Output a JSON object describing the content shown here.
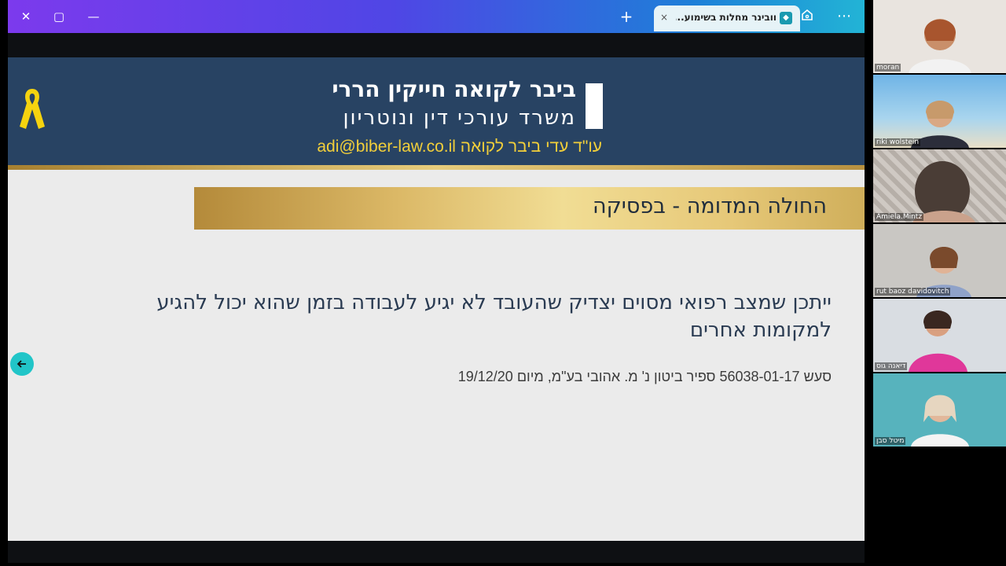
{
  "browser": {
    "tab_title": "וובינר מחלות בשימוע...",
    "tab_close": "×",
    "new_tab": "+",
    "more": "⋯",
    "window_close": "✕",
    "window_max": "▢",
    "window_min": "—"
  },
  "slide": {
    "firm_name": "ביבר לקואה חייקין הררי",
    "firm_subtitle": "משרד עורכי דין ונוטריון",
    "firm_contact": "עו\"ד עדי ביבר לקואה adi@biber-law.co.il",
    "title": "החולה המדומה - בפסיקה",
    "body": "ייתכן שמצב רפואי מסוים יצדיק שהעובד לא יגיע לעבודה בזמן שהוא יכול להגיע למקומות אחרים",
    "citation": "סעש 56038-01-17 ספיר ביטון נ' מ. אהובי בע\"מ, מיום 19/12/20"
  },
  "participants": [
    {
      "name": "moran",
      "bg": "#e9e4df"
    },
    {
      "name": "riki wolstein",
      "bg": "#7fb9d9"
    },
    {
      "name": "Amiela.Mintz",
      "bg": "#b8b2ad"
    },
    {
      "name": "rut baoz davidovitch",
      "bg": "#c9c7c3"
    },
    {
      "name": "דיאנה גוס",
      "bg": "#d9dde2"
    },
    {
      "name": "מיטל סבן",
      "bg": "#57b3bd"
    }
  ],
  "colors": {
    "slide_header": "#284363",
    "gold_accent": "#d8b767",
    "contact_yellow": "#f2cf3a",
    "nav_button": "#21c5c8"
  }
}
